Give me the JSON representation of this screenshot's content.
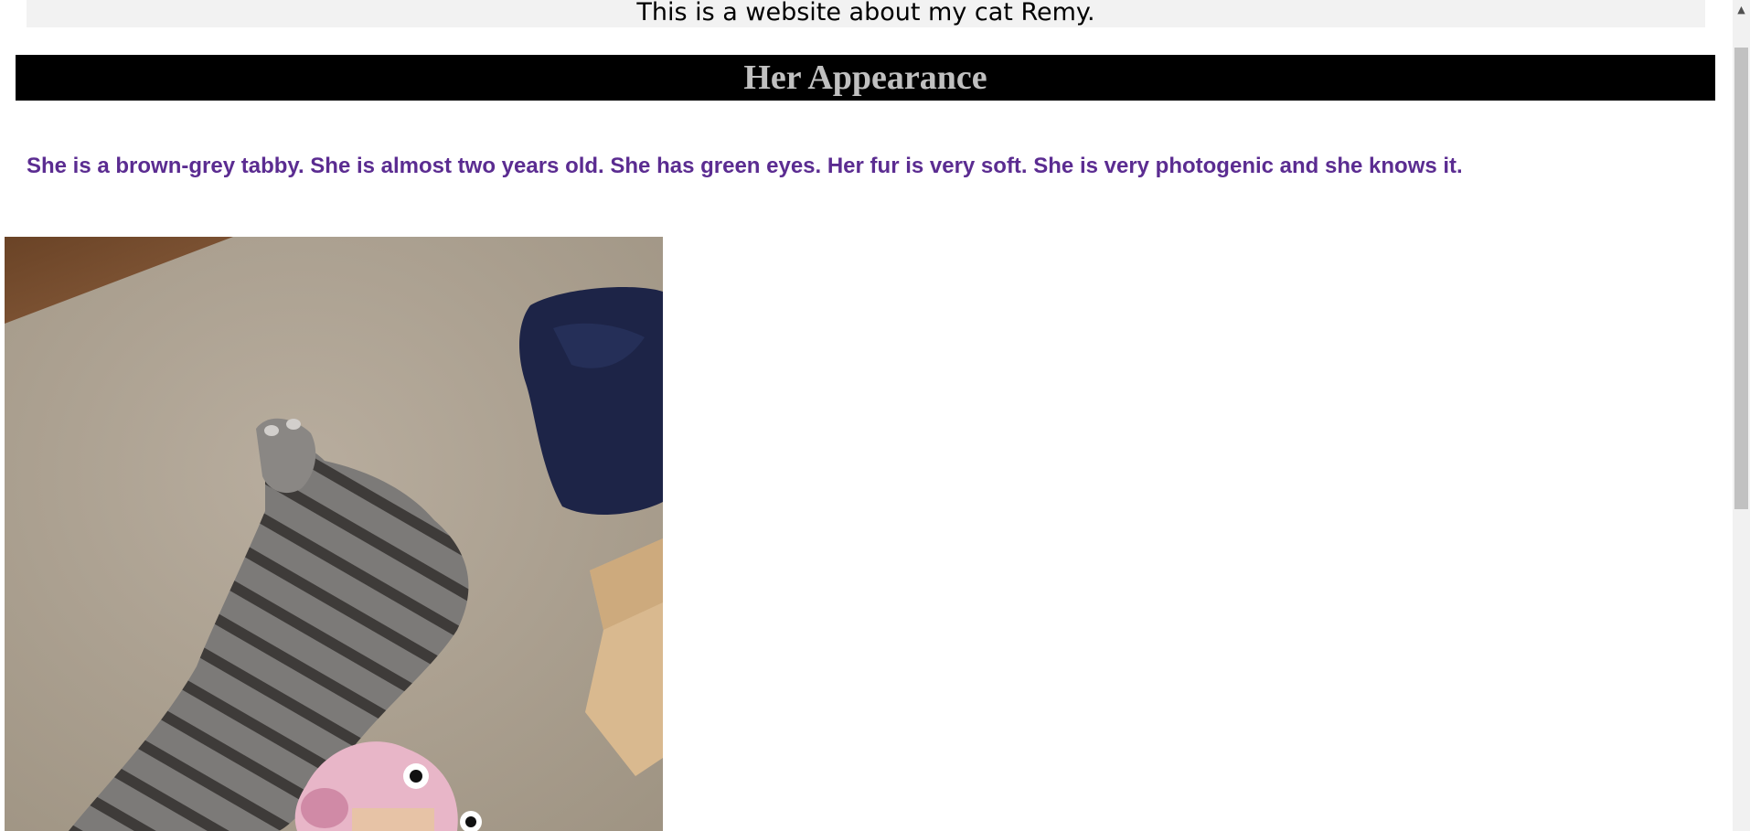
{
  "site": {
    "banner_text": "This is a website about my cat Remy."
  },
  "section": {
    "heading": "Her Appearance",
    "description": "She is a brown-grey tabby. She is almost two years old. She has green eyes. Her fur is very soft. She is very photogenic and she knows it."
  },
  "colors": {
    "heading_bar": "#000000",
    "heading_text": "#c0c0c0",
    "description_text": "#5b2c91",
    "banner_background": "#f2f2f2"
  },
  "photo": {
    "subject": "tabby cat lying on carpet"
  },
  "scrollbar": {
    "up_arrow_icon": "triangle-up-icon"
  }
}
